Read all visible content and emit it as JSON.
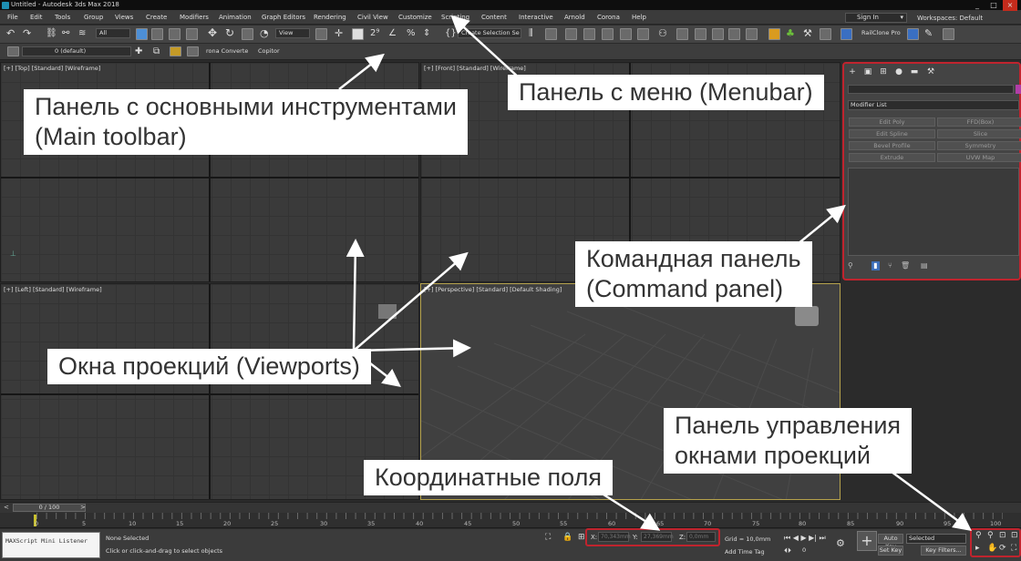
{
  "window": {
    "title": "Untitled - Autodesk 3ds Max 2018",
    "controls": [
      "_",
      "□",
      "×"
    ]
  },
  "menubar": {
    "items": [
      "File",
      "Edit",
      "Tools",
      "Group",
      "Views",
      "Create",
      "Modifiers",
      "Animation",
      "Graph Editors",
      "Rendering",
      "Civil View",
      "Customize",
      "Scripting",
      "Content",
      "Interactive",
      "Arnold",
      "Corona",
      "Help"
    ],
    "sign_in": "Sign In",
    "workspaces_label": "Workspaces:",
    "workspaces_value": "Default"
  },
  "main_toolbar": {
    "selection_filter": "All",
    "view_dropdown": "View",
    "selection_set": "Create Selection Se",
    "railclone": "RailClone Pro",
    "layer": "0 (default)",
    "corona_converter": "rona Converte",
    "copitor": "Copitor"
  },
  "viewports": {
    "top": "[+] [Top] [Standard] [Wireframe]",
    "front": "[+] [Front] [Standard] [Wireframe]",
    "left": "[+] [Left] [Standard] [Wireframe]",
    "perspective": "[+] [Perspective] [Standard] [Default Shading]"
  },
  "command_panel": {
    "modifier_list": "Modifier List",
    "buttons": [
      "Edit Poly",
      "FFD(Box)",
      "Edit Spline",
      "Slice",
      "Bevel Profile",
      "Symmetry",
      "Extrude",
      "UVW Map"
    ]
  },
  "timeline": {
    "slider": "0 / 100",
    "ticks": [
      "0",
      "5",
      "10",
      "15",
      "20",
      "25",
      "30",
      "35",
      "40",
      "45",
      "50",
      "55",
      "60",
      "65",
      "70",
      "75",
      "80",
      "85",
      "90",
      "95",
      "100"
    ]
  },
  "status": {
    "listener": "MAXScript Mini Listener",
    "selection": "None Selected",
    "prompt": "Click or click-and-drag to select objects",
    "x_label": "X:",
    "x_value": "70,343mm",
    "y_label": "Y:",
    "y_value": "27,369mm",
    "z_label": "Z:",
    "z_value": "0,0mm",
    "grid": "Grid = 10,0mm",
    "add_time_tag": "Add Time Tag",
    "auto_key": "Auto Key",
    "set_key": "Set Key",
    "selected": "Selected",
    "key_filters": "Key Filters...",
    "frame": "0"
  },
  "annotations": {
    "main_toolbar": [
      "Панель с основными инструментами",
      "(Main toolbar)"
    ],
    "menubar": "Панель с меню (Menubar)",
    "command_panel": [
      "Командная панель",
      "(Command panel)"
    ],
    "viewports": "Окна проекций (Viewports)",
    "viewport_nav": [
      "Панель управления",
      "окнами проекций"
    ],
    "coordinates": "Координатные поля"
  },
  "colors": {
    "highlight_border": "#c0242e",
    "callout_bg": "#ffffff",
    "arrow": "#ffffff"
  }
}
